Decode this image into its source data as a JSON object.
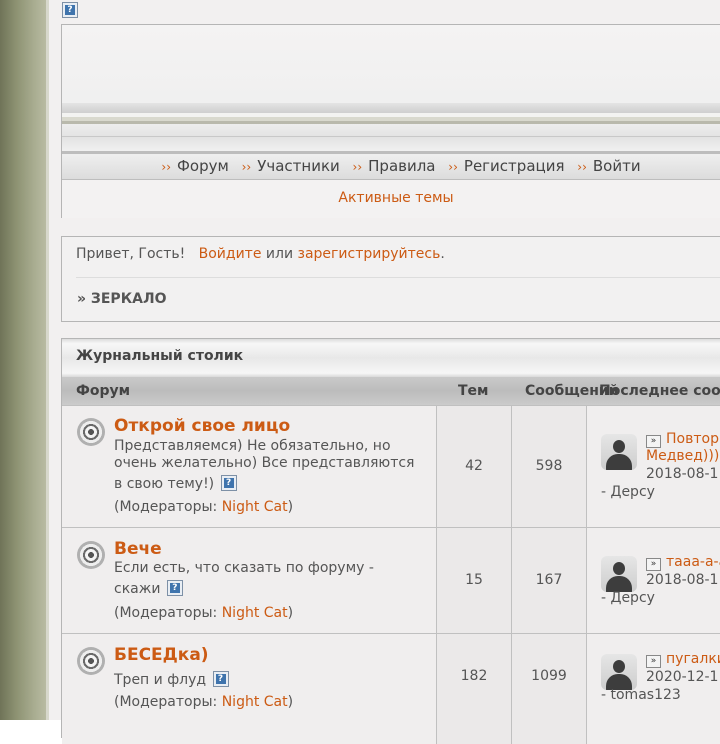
{
  "nav": {
    "items": [
      "Форум",
      "Участники",
      "Правила",
      "Регистрация",
      "Войти"
    ],
    "active_topics": "Активные темы"
  },
  "welcome": {
    "greeting": "Привет, Гость!",
    "login_link": "Войдите",
    "or": "или",
    "register_link": "зарегистрируйтесь",
    "period": ".",
    "mirror": "» ЗЕРКАЛО"
  },
  "category": {
    "title": "Журнальный столик",
    "columns": [
      "Форум",
      "Тем",
      "Сообщений",
      "Последнее соо"
    ]
  },
  "forums": [
    {
      "title": "Открой свое лицо",
      "desc": "Представляемся) Не обязательно, но очень желательно) Все представляются в свою тему!)",
      "mods_prefix": "(Модераторы: ",
      "mod": "Night Cat",
      "mods_suffix": ")",
      "topics": "42",
      "posts": "598",
      "last_title": "Повтор",
      "last_title2": "Медвед)))",
      "last_date": "2018-08-1",
      "last_author": "- Дерсу"
    },
    {
      "title": "Вече",
      "desc": "Если есть, что сказать по форуму - скажи",
      "mods_prefix": "(Модераторы: ",
      "mod": "Night Cat",
      "mods_suffix": ")",
      "topics": "15",
      "posts": "167",
      "last_title": "тааа-а-а",
      "last_date": "2018-08-1",
      "last_author": "- Дерсу"
    },
    {
      "title": "БЕСЕДка)",
      "desc": "Треп и флуд",
      "mods_prefix": "(Модераторы: ",
      "mod": "Night Cat",
      "mods_suffix": ")",
      "topics": "182",
      "posts": "1099",
      "last_title": "пугалки",
      "last_date": "2020-12-1",
      "last_author": "- tomas123"
    }
  ],
  "icons": {
    "help": "help-icon",
    "nav_arrow": "double-chevron-icon",
    "forum": "forum-status-icon",
    "avatar": "default-avatar-icon",
    "last_post": "last-post-arrow-icon"
  },
  "colors": {
    "accent": "#cc5b14",
    "sidebar": "#8d9272"
  }
}
